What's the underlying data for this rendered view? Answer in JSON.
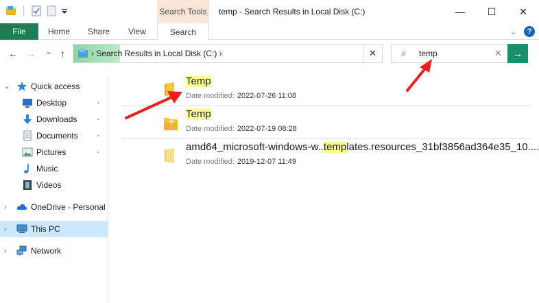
{
  "titlebar": {
    "window_title": "temp - Search Results in Local Disk (C:)",
    "context_tab_label": "Search Tools",
    "minimize_glyph": "—",
    "maximize_glyph": "☐",
    "close_glyph": "✕"
  },
  "ribbon": {
    "tabs": [
      {
        "label": "File"
      },
      {
        "label": "Home"
      },
      {
        "label": "Share"
      },
      {
        "label": "View"
      },
      {
        "label": "Search"
      }
    ],
    "collapse_glyph": "⌄",
    "help_glyph": "?"
  },
  "address": {
    "back_glyph": "←",
    "forward_glyph": "→",
    "recent_glyph": "⌄",
    "up_glyph": "↑",
    "path": "›  Search Results in Local Disk (C:)  ›",
    "clear_glyph": "✕"
  },
  "search": {
    "value": "temp",
    "search_glyph": "⌕",
    "clear_glyph": "✕",
    "go_glyph": "→"
  },
  "sidebar": {
    "items": [
      {
        "label": "Quick access",
        "icon": "star-icon"
      },
      {
        "label": "Desktop",
        "icon": "desktop-icon"
      },
      {
        "label": "Downloads",
        "icon": "download-icon"
      },
      {
        "label": "Documents",
        "icon": "document-icon"
      },
      {
        "label": "Pictures",
        "icon": "pictures-icon"
      },
      {
        "label": "Music",
        "icon": "music-icon"
      },
      {
        "label": "Videos",
        "icon": "video-icon"
      },
      {
        "label": "OneDrive - Personal",
        "icon": "cloud-icon"
      },
      {
        "label": "This PC",
        "icon": "computer-icon"
      },
      {
        "label": "Network",
        "icon": "network-icon"
      }
    ],
    "expand_glyph": "›",
    "expanded_glyph": "⌄",
    "pin_glyph": "📌"
  },
  "results": {
    "date_label": "Date modified:",
    "items": [
      {
        "name_pre": "",
        "name_hl": "Temp",
        "name_post": "",
        "date": "2022-07-26 11:08"
      },
      {
        "name_pre": "",
        "name_hl": "Temp",
        "name_post": "",
        "date": "2022-07-19 08:28"
      },
      {
        "name_pre": "amd64_microsoft-windows-w..",
        "name_hl": "temp",
        "name_post": "lates.resources_31bf3856ad364e35_10....",
        "date": "2019-12-07 11:49"
      }
    ]
  },
  "colors": {
    "file_tab": "#1a7f55",
    "context_tab": "#fbe5d6",
    "highlight": "#ffff99",
    "selection": "#cce8ff",
    "arrow": "#e8211f",
    "folder": "#f4c542"
  }
}
